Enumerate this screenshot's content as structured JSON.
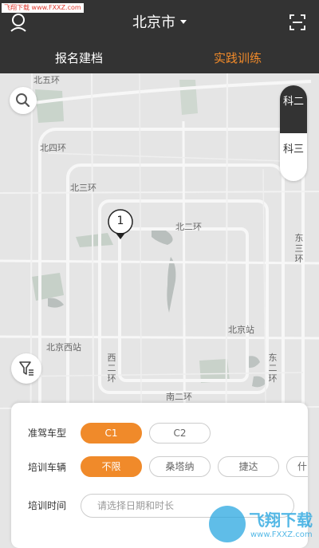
{
  "watermark_top": "飞翔下载 www.FXXZ.com",
  "header": {
    "city": "北京市",
    "tabs": [
      {
        "label": "报名建档",
        "active": false
      },
      {
        "label": "实践训练",
        "active": true
      }
    ]
  },
  "map": {
    "labels": {
      "north_5th_ring": "北五环",
      "north_4th_ring": "北四环",
      "north_3rd_ring": "北三环",
      "north_2nd_ring": "北二环",
      "east_3rd_ring": "东三环",
      "beijing_station": "北京站",
      "beijing_west_station": "北京西站",
      "west_2nd_ring": "西二环",
      "east_2nd_ring": "东二环",
      "south_2nd_ring": "南二环"
    },
    "marker_count": "1"
  },
  "subject_switch": {
    "items": [
      "科二",
      "科三"
    ],
    "active_index": 0
  },
  "filters": {
    "license_type": {
      "label": "准驾车型",
      "options": [
        "C1",
        "C2"
      ],
      "selected": "C1"
    },
    "vehicle": {
      "label": "培训车辆",
      "options": [
        "不限",
        "桑塔纳",
        "捷达",
        "什"
      ],
      "selected": "不限"
    },
    "time": {
      "label": "培训时间",
      "placeholder": "请选择日期和时长"
    }
  },
  "watermark_logo": {
    "title": "飞翔下载",
    "url": "www.FXXZ.com"
  },
  "colors": {
    "header_bg": "#333333",
    "accent": "#f08a2a",
    "map_bg": "#e5e5e5"
  }
}
